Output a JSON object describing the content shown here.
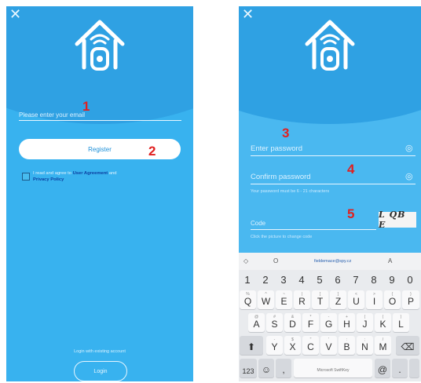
{
  "left_screen": {
    "close_glyph": "✕",
    "email_placeholder": "Please enter your email",
    "register_label": "Register",
    "agreement_prefix": "I read and agree to ",
    "user_agreement": "User Agreement",
    "and": " and",
    "privacy_policy": "Privacy Policy",
    "login_prompt": "Login with existing account",
    "login_label": "Login",
    "markers": [
      "1",
      "2"
    ]
  },
  "right_screen": {
    "close_glyph": "✕",
    "password_placeholder": "Enter password",
    "confirm_placeholder": "Confirm password",
    "password_hint": "Your password must be 6 - 21 characters",
    "code_placeholder": "Code",
    "code_hint": "Click the picture to change code",
    "captcha_text": "L QB E",
    "markers": [
      "3",
      "4",
      "5"
    ]
  },
  "keyboard": {
    "suggest": [
      "◇",
      "O",
      "fieldemace@spy.cz",
      "A"
    ],
    "numbers": [
      "1",
      "2",
      "3",
      "4",
      "5",
      "6",
      "7",
      "8",
      "9",
      "0"
    ],
    "row1": [
      {
        "m": "Q",
        "s": "%"
      },
      {
        "m": "W",
        "s": "^"
      },
      {
        "m": "E",
        "s": "~"
      },
      {
        "m": "R",
        "s": "|"
      },
      {
        "m": "T",
        "s": "["
      },
      {
        "m": "Z",
        "s": "]"
      },
      {
        "m": "U",
        "s": "<"
      },
      {
        "m": "I",
        "s": ">"
      },
      {
        "m": "O",
        "s": "{"
      },
      {
        "m": "P",
        "s": "}"
      }
    ],
    "row2": [
      {
        "m": "A",
        "s": "@"
      },
      {
        "m": "S",
        "s": "#"
      },
      {
        "m": "D",
        "s": "&"
      },
      {
        "m": "F",
        "s": "*"
      },
      {
        "m": "G",
        "s": "-"
      },
      {
        "m": "H",
        "s": "+"
      },
      {
        "m": "J",
        "s": "("
      },
      {
        "m": "K",
        "s": "("
      },
      {
        "m": "L",
        "s": ")"
      }
    ],
    "row3": [
      {
        "m": "Y",
        "s": "-"
      },
      {
        "m": "X",
        "s": "$"
      },
      {
        "m": "C",
        "s": "\""
      },
      {
        "m": "V",
        "s": "'"
      },
      {
        "m": "B",
        "s": ":"
      },
      {
        "m": "N",
        "s": ";"
      },
      {
        "m": "M",
        "s": "/"
      }
    ],
    "shift": "⬆",
    "backspace": "⌫",
    "sym": "123",
    "emoji": "☺",
    "comma": ",",
    "space_label": "Microsoft SwiftKey",
    "at": "@",
    "period": "."
  }
}
